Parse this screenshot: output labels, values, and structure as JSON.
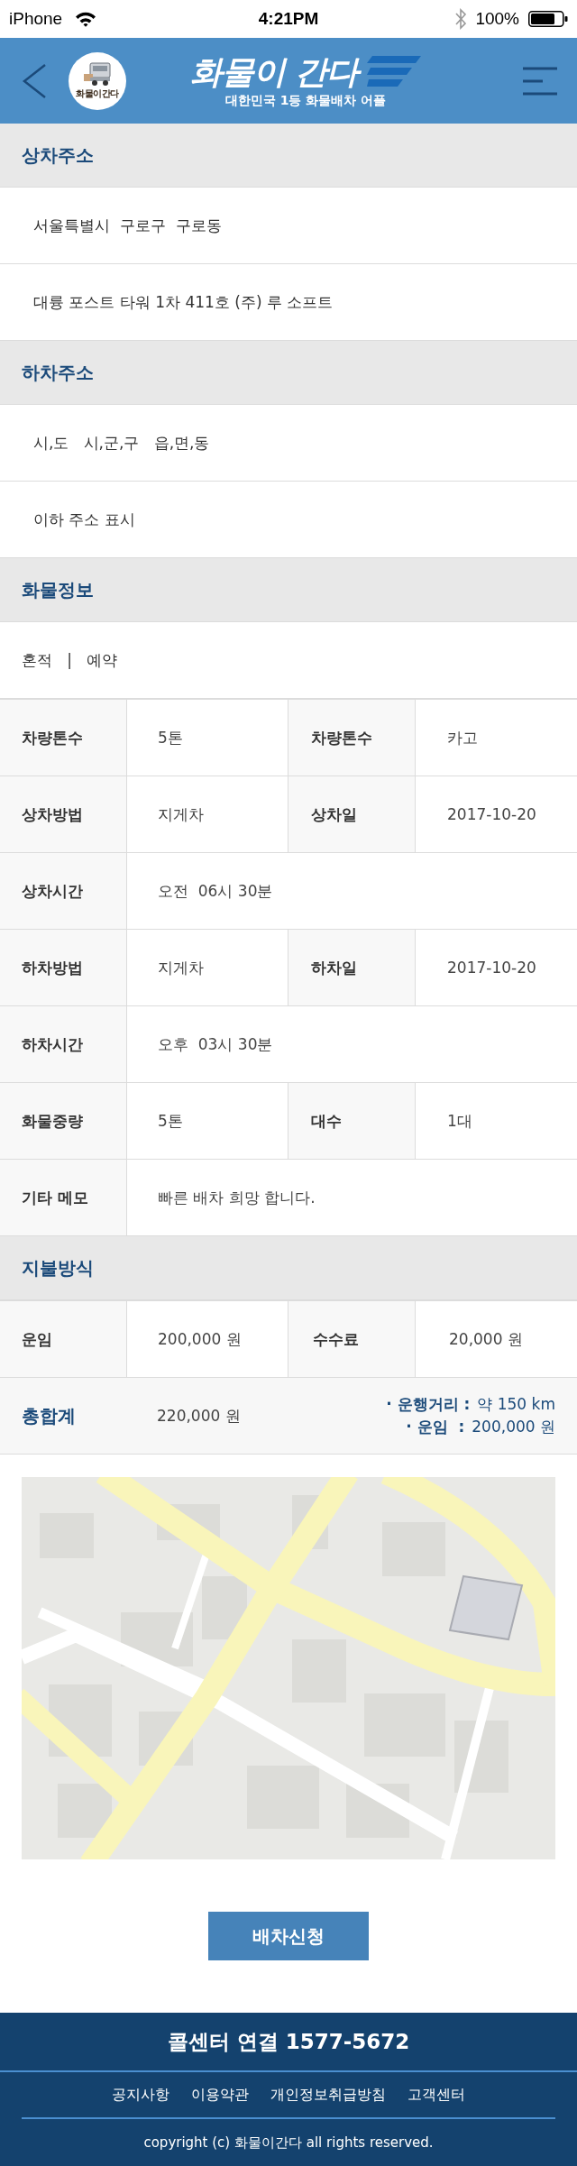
{
  "status_bar": {
    "carrier": "iPhone",
    "time": "4:21PM",
    "battery": "100%"
  },
  "header": {
    "logo_text": "화물이간다",
    "title": "화물이 간다",
    "subtitle": "대한민국 1등 화물배차 어플"
  },
  "pickup_address": {
    "title": "상차주소",
    "lines": [
      "서울특별시  구로구  구로동",
      "대륭 포스트 타워 1차 411호 (주) 루 소프트"
    ]
  },
  "dropoff_address": {
    "title": "하차주소",
    "lines": [
      "시,도   시,군,구   읍,면,동",
      "이하 주소 표시"
    ]
  },
  "cargo_info": {
    "title": "화물정보",
    "load_type": "혼적   |   예약",
    "rows": [
      {
        "cells": [
          {
            "label": "차량톤수",
            "value": "5톤"
          },
          {
            "label": "차량톤수",
            "value": "카고"
          }
        ]
      },
      {
        "cells": [
          {
            "label": "상차방법",
            "value": "지게차"
          },
          {
            "label": "상차일",
            "value": "2017-10-20"
          }
        ]
      },
      {
        "cells": [
          {
            "label": "상차시간",
            "value": "오전  06시 30분"
          }
        ]
      },
      {
        "cells": [
          {
            "label": "하차방법",
            "value": "지게차"
          },
          {
            "label": "하차일",
            "value": "2017-10-20"
          }
        ]
      },
      {
        "cells": [
          {
            "label": "하차시간",
            "value": "오후  03시 30분"
          }
        ]
      },
      {
        "cells": [
          {
            "label": "화물중량",
            "value": "5톤"
          },
          {
            "label": "대수",
            "value": "1대"
          }
        ]
      },
      {
        "cells": [
          {
            "label": "기타 메모",
            "value": "빠른 배차 희망 합니다."
          }
        ]
      }
    ]
  },
  "payment": {
    "title": "지불방식",
    "fees": [
      {
        "label": "운임",
        "value": "200,000 원"
      },
      {
        "label": "수수료",
        "value": "20,000 원"
      }
    ],
    "total": {
      "label": "총합계",
      "value": "220,000 원",
      "details": [
        {
          "label": "· 운행거리 :",
          "value": "약 150 km"
        },
        {
          "label": "· 운임  :",
          "value": "200,000 원"
        }
      ]
    }
  },
  "submit_button": "배차신청",
  "footer": {
    "call_center": "콜센터 연결 1577-5672",
    "links": [
      "공지사항",
      "이용약관",
      "개인정보취급방침",
      "고객센터"
    ],
    "copyright": "copyright (c) 화물이간다 all rights reserved."
  }
}
